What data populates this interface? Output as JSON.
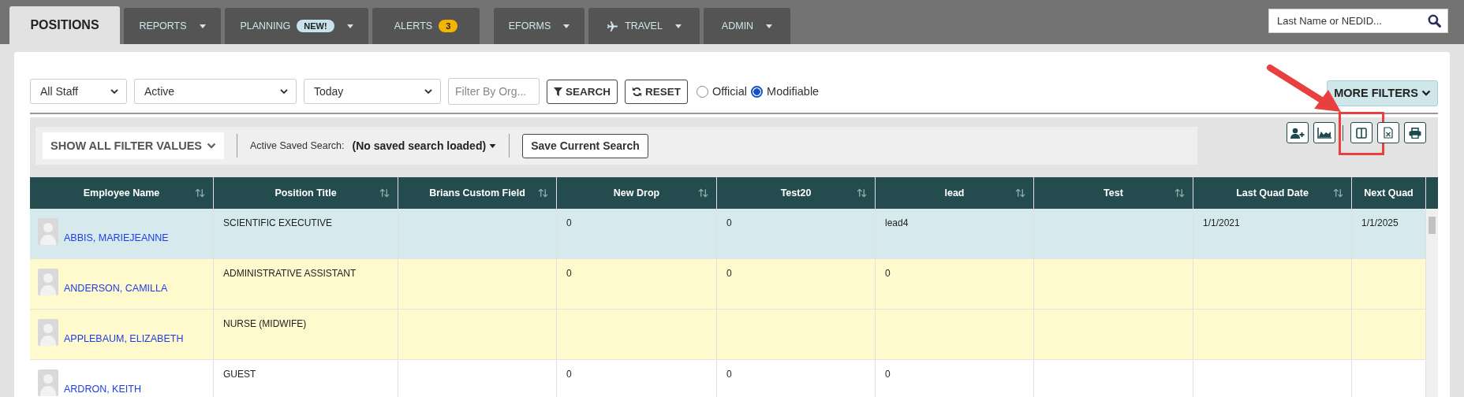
{
  "nav": {
    "tabs": [
      {
        "label": "POSITIONS",
        "selected": true,
        "dropdown": false
      },
      {
        "label": "REPORTS",
        "selected": false,
        "dropdown": true
      },
      {
        "label": "PLANNING",
        "selected": false,
        "dropdown": true,
        "badge": {
          "text": "NEW!",
          "kind": "new"
        }
      },
      {
        "label": "ALERTS",
        "selected": false,
        "dropdown": false,
        "badge": {
          "text": "3",
          "kind": "count"
        }
      },
      {
        "label": "EFORMS",
        "selected": false,
        "dropdown": true
      },
      {
        "label": "TRAVEL",
        "selected": false,
        "dropdown": true,
        "kind": "travel"
      },
      {
        "label": "ADMIN",
        "selected": false,
        "dropdown": true
      }
    ],
    "search": {
      "placeholder": "Last Name or NEDID..."
    }
  },
  "filters": {
    "selects": [
      {
        "value": "All Staff"
      },
      {
        "value": "Active"
      },
      {
        "value": "Today"
      }
    ],
    "org_field": {
      "placeholder": "Filter By Org..."
    },
    "buttons": [
      {
        "label": "SEARCH",
        "kind": "search"
      },
      {
        "label": "RESET",
        "kind": "reset"
      }
    ],
    "mode": [
      {
        "label": "Official",
        "selected": false
      },
      {
        "label": "Modifiable",
        "selected": true
      }
    ],
    "more_filters": "MORE FILTERS"
  },
  "toolbar": {
    "show_all": "SHOW ALL FILTER VALUES",
    "saved_search_label": "Active Saved Search:",
    "saved_search_value": "(No saved search loaded)",
    "save_button": "Save Current Search",
    "tools": [
      {
        "kind": "add-person",
        "highlighted": false
      },
      {
        "kind": "chart",
        "highlighted": false
      },
      {
        "kind": "separator"
      },
      {
        "kind": "columns",
        "highlighted": true
      },
      {
        "kind": "excel",
        "highlighted": false
      },
      {
        "kind": "print",
        "highlighted": false
      }
    ]
  },
  "table": {
    "columns": [
      {
        "label": "Employee Name",
        "sortable": true
      },
      {
        "label": "Position Title",
        "sortable": true
      },
      {
        "label": "Brians Custom Field",
        "sortable": true
      },
      {
        "label": "New Drop",
        "sortable": true
      },
      {
        "label": "Test20",
        "sortable": true
      },
      {
        "label": "lead",
        "sortable": true
      },
      {
        "label": "Test",
        "sortable": true
      },
      {
        "label": "Last Quad Date",
        "sortable": true
      },
      {
        "label": "Next Quad",
        "sortable": false
      }
    ],
    "rows": [
      {
        "selected": true,
        "highlighted": false,
        "cells": [
          "ABBIS, MARIEJEANNE",
          "SCIENTIFIC EXECUTIVE",
          "",
          "0",
          "0",
          "lead4",
          "",
          "1/1/2021",
          "1/1/2025"
        ]
      },
      {
        "selected": false,
        "highlighted": true,
        "cells": [
          "ANDERSON, CAMILLA",
          "ADMINISTRATIVE ASSISTANT",
          "",
          "0",
          "0",
          "0",
          "",
          "",
          ""
        ]
      },
      {
        "selected": false,
        "highlighted": true,
        "cells": [
          "APPLEBAUM, ELIZABETH",
          "NURSE (MIDWIFE)",
          "",
          "",
          "",
          "",
          "",
          "",
          ""
        ]
      },
      {
        "selected": false,
        "highlighted": false,
        "cells": [
          "ARDRON, KEITH",
          "GUEST",
          "",
          "0",
          "0",
          "0",
          "",
          "",
          ""
        ]
      }
    ]
  }
}
